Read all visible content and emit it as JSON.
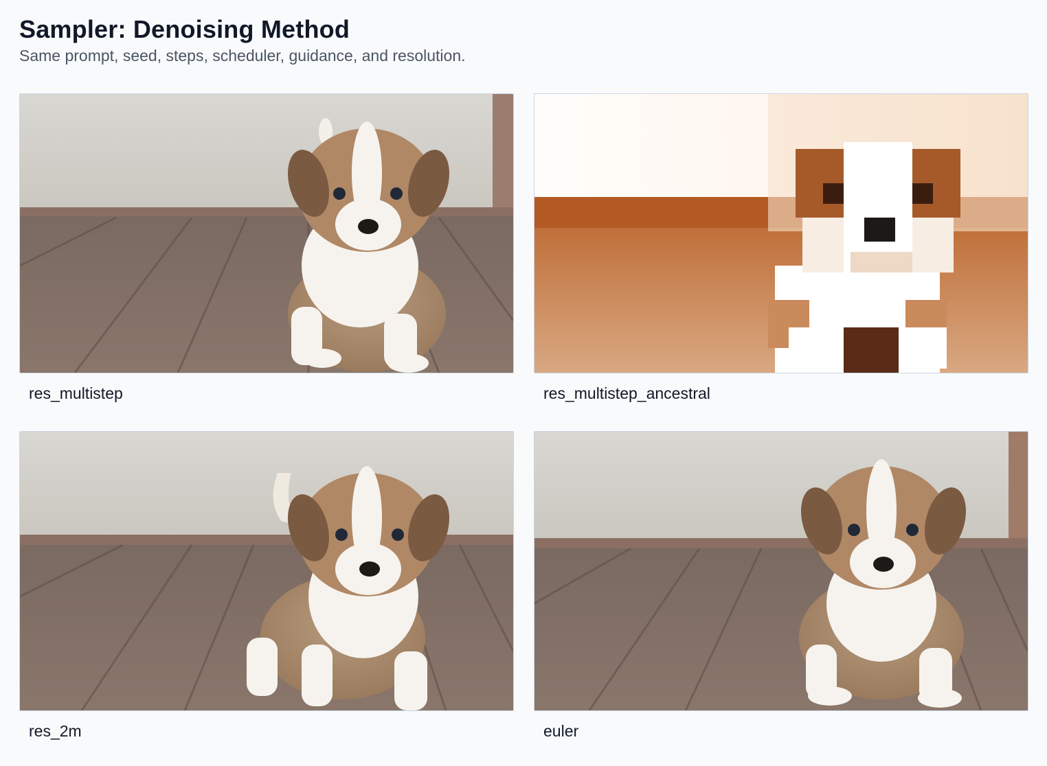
{
  "header": {
    "title": "Sampler: Denoising Method",
    "subtitle": "Same prompt, seed, steps, scheduler, guidance, and resolution."
  },
  "samples": [
    {
      "label": "res_multistep",
      "image": "puppy-photo"
    },
    {
      "label": "res_multistep_ancestral",
      "image": "puppy-photo-pixelated-overexposed"
    },
    {
      "label": "res_2m",
      "image": "puppy-photo"
    },
    {
      "label": "euler",
      "image": "puppy-photo"
    }
  ]
}
